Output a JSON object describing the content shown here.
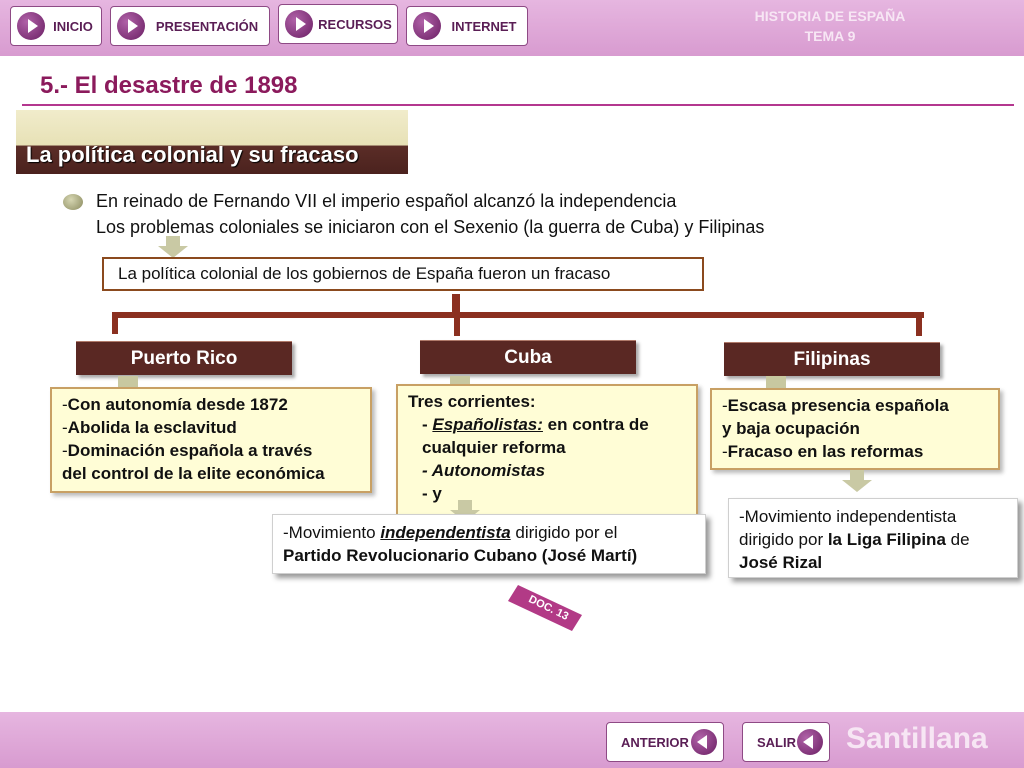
{
  "nav": {
    "items": [
      {
        "label": "INICIO"
      },
      {
        "label": "PRESENTACIÓN"
      },
      {
        "label": "RECURSOS"
      },
      {
        "label": "INTERNET"
      }
    ],
    "brand_line1": "HISTORIA DE ESPAÑA",
    "brand_line2": "TEMA 9"
  },
  "title": "5.- El desastre de 1898",
  "section": "La política colonial y su fracaso",
  "intro": {
    "line1": "En reinado de Fernando VII el imperio español alcanzó la independencia",
    "line2": "Los problemas coloniales se iniciaron con el Sexenio (la guerra de Cuba) y Filipinas"
  },
  "summary": "La política colonial de los gobiernos de España fueron un fracaso",
  "columns": {
    "puerto_rico": {
      "title": "Puerto Rico",
      "l1_dash": "-",
      "l1": "Con autonomía desde 1872",
      "l2_dash": "-",
      "l2": "Abolida la esclavitud",
      "l3_dash": "-",
      "l3": "Dominación española  a través",
      "l4": "del control de la elite económica"
    },
    "cuba": {
      "title": "Cuba",
      "heading": "Tres corrientes:",
      "c1_prefix": "- ",
      "c1_term": "Españolistas:",
      "c1_rest": " en contra de cualquier reforma",
      "c2": "- Autonomistas",
      "c3": "- y",
      "indep_prefix": "-Movimiento ",
      "indep_term": "independentista",
      "indep_rest": " dirigido por el",
      "indep_line2": "Partido Revolucionario Cubano (José Martí)"
    },
    "filipinas": {
      "title": "Filipinas",
      "l1_dash": "-",
      "l1": "Escasa presencia española",
      "l2": "y baja ocupación",
      "l3_dash": "-",
      "l3": "Fracaso en las reformas",
      "mov_l1": "-Movimiento independentista",
      "mov_l2_prefix": "dirigido por ",
      "mov_l2_bold": "la Liga Filipina",
      "mov_l2_suffix": " de",
      "mov_l3": "José Rizal"
    }
  },
  "doc_tag": "DOC. 13",
  "bottom": {
    "prev": "ANTERIOR",
    "exit": "SALIR",
    "brand": "Santillana"
  }
}
